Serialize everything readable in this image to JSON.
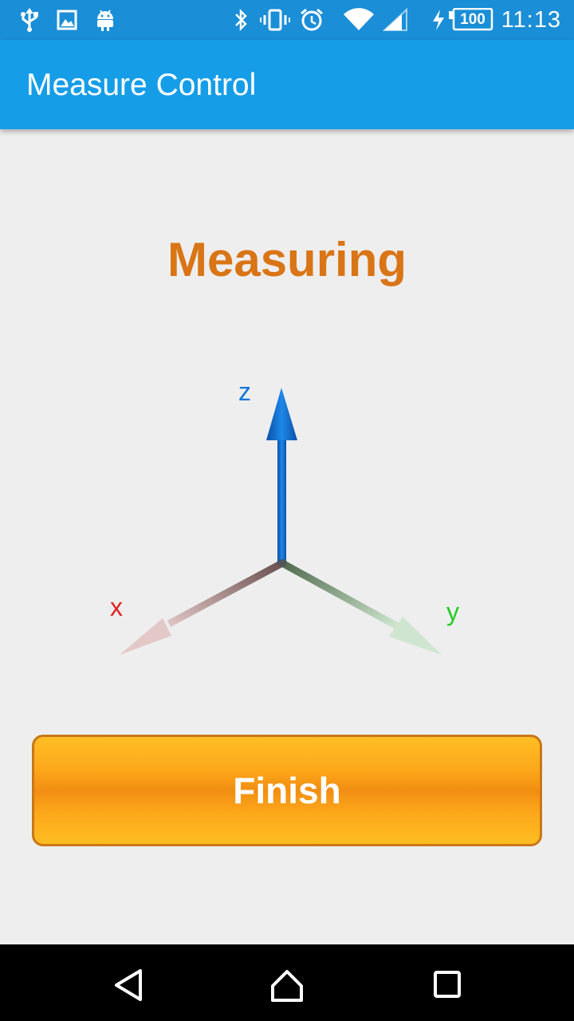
{
  "status_bar": {
    "time": "11:13",
    "battery_level": "100",
    "background_color": "#1a8ed6",
    "left_icons": [
      "usb-icon",
      "image-icon",
      "android-icon"
    ],
    "right_icons": [
      "bluetooth-icon",
      "vibrate-icon",
      "alarm-icon",
      "wifi-icon",
      "signal-icon",
      "charging-icon",
      "battery-icon"
    ]
  },
  "app_bar": {
    "title": "Measure Control",
    "background_color": "#169de8"
  },
  "main": {
    "status_title": "Measuring",
    "status_color": "#d97516",
    "axes": {
      "x_label": "x",
      "y_label": "y",
      "z_label": "z",
      "x_color": "#e02020",
      "y_color": "#22cc22",
      "z_color": "#1177dd"
    },
    "finish_label": "Finish"
  },
  "nav_bar": {
    "buttons": [
      "back-icon",
      "home-icon",
      "recents-icon"
    ]
  }
}
